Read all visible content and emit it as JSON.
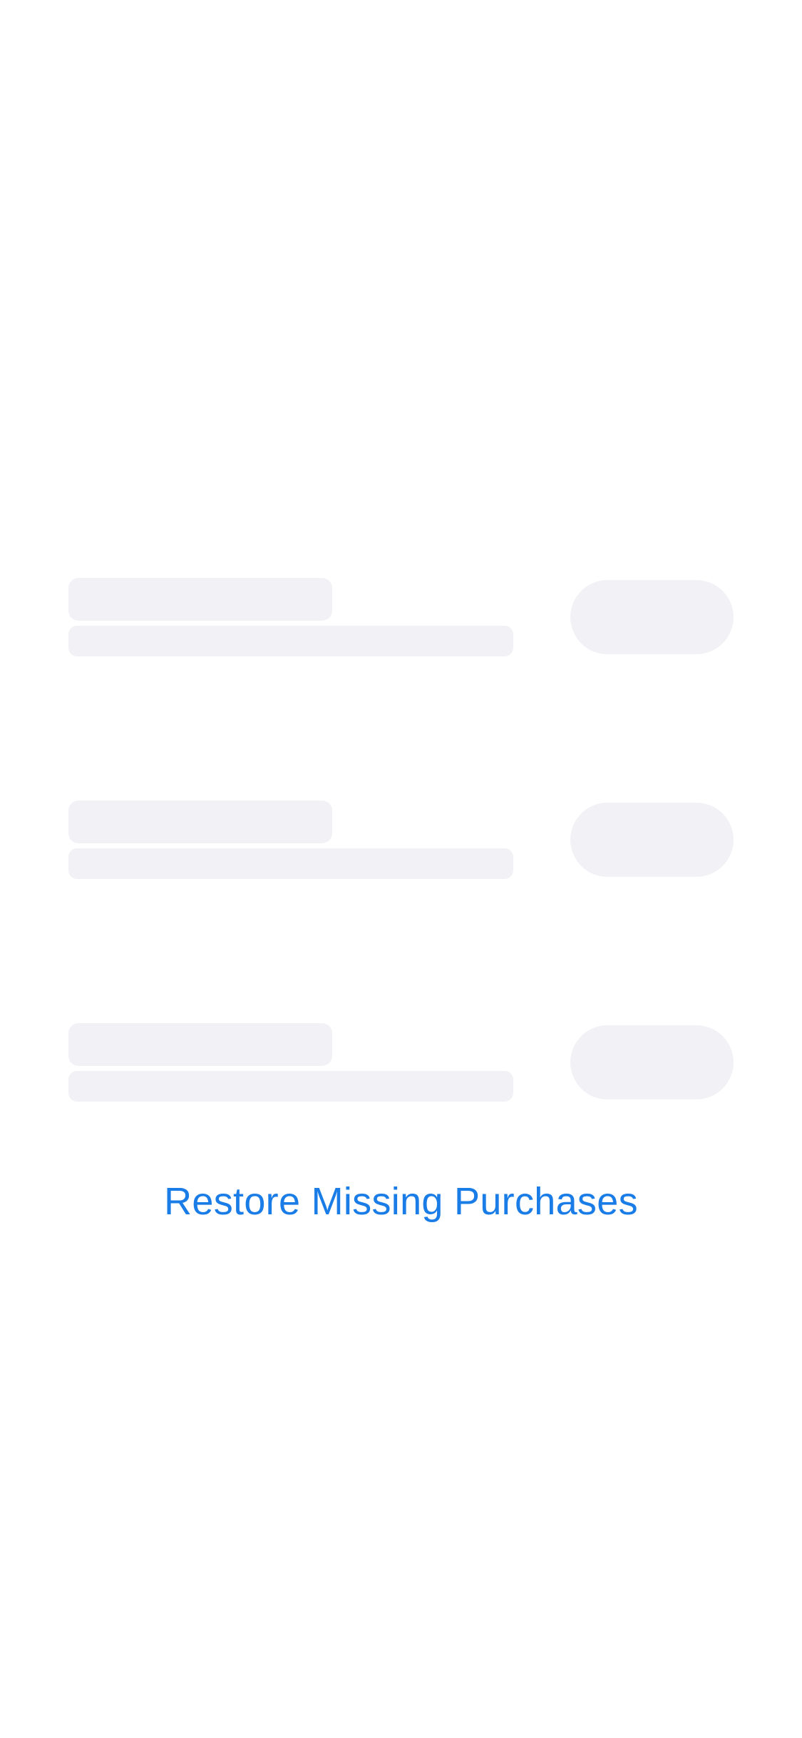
{
  "colors": {
    "background": "#FFFFFF",
    "skeleton": "#F2F2F6",
    "link": "#1A7CE6"
  },
  "skeleton_rows": [
    {
      "state": "loading"
    },
    {
      "state": "loading"
    },
    {
      "state": "loading"
    }
  ],
  "restore": {
    "label": "Restore Missing Purchases"
  }
}
